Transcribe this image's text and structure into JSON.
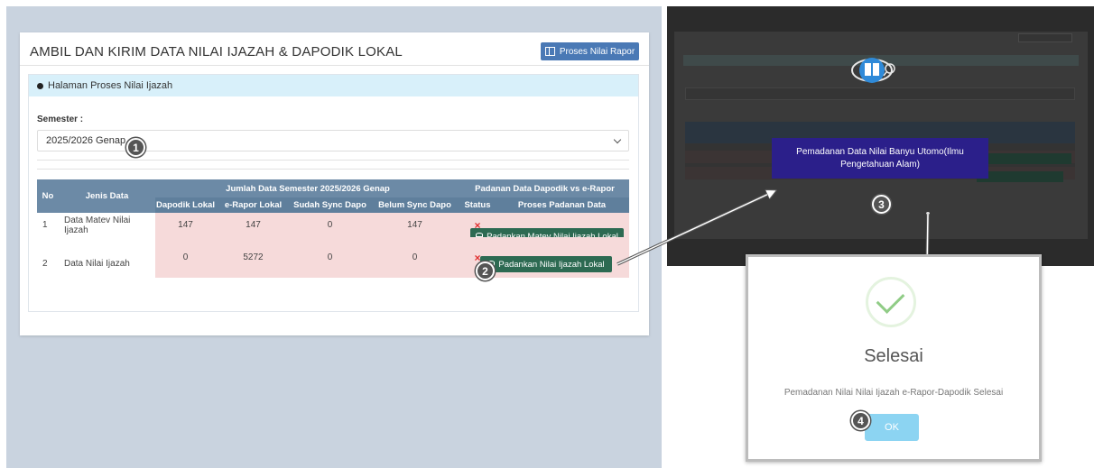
{
  "main": {
    "title": "AMBIL DAN KIRIM DATA NILAI IJAZAH & DAPODIK LOKAL",
    "rapor_button": "Proses Nilai Rapor",
    "section_title": "Halaman Proses Nilai Ijazah",
    "semester_label": "Semester :",
    "semester_value": "2025/2026 Genap"
  },
  "table": {
    "col_no": "No",
    "col_jenis": "Jenis Data",
    "group_jumlah": "Jumlah Data Semester 2025/2026 Genap",
    "group_padanan": "Padanan Data Dapodik vs e-Rapor",
    "sub_headers": [
      "Dapodik Lokal",
      "e-Rapor Lokal",
      "Sudah Sync Dapo",
      "Belum Sync Dapo",
      "Status",
      "Proses Padanan Data"
    ],
    "rows": [
      {
        "no": "1",
        "jenis": "Data Matev Nilai Ijazah",
        "dapodik": "147",
        "erapor": "147",
        "sudah": "0",
        "belum": "147",
        "status": "×",
        "action": "Padankan Matev Nilai Ijazah Lokal"
      },
      {
        "no": "2",
        "jenis": "Data Nilai Ijazah",
        "dapodik": "0",
        "erapor": "5272",
        "sudah": "0",
        "belum": "0",
        "status": "×",
        "action": "Padankan Nilai Ijazah Lokal"
      }
    ]
  },
  "badges": {
    "b1": "1",
    "b2": "2",
    "b3": "3",
    "b4": "4"
  },
  "overlay": {
    "tooltip": "Pemadanan Data Nilai Banyu Utomo(Ilmu Pengetahuan Alam)"
  },
  "dialog": {
    "title": "Selesai",
    "message": "Pemadanan Nilai Nilai Ijazah e-Rapor-Dapodik Selesai",
    "ok": "OK"
  },
  "colors": {
    "header_blue": "#6c8aa6",
    "action_green": "#2d6a52",
    "tooltip_indigo": "#2b1f8a",
    "ok_button": "#8cd4f2"
  }
}
